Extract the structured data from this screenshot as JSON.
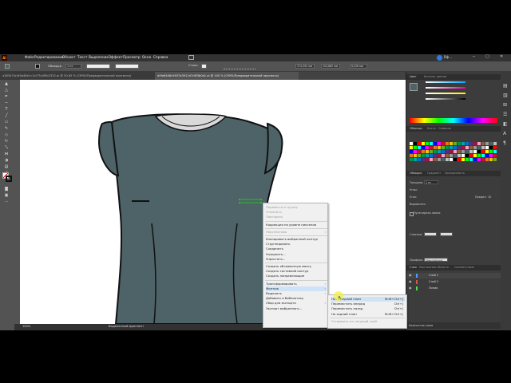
{
  "app": {
    "logo": "Ai",
    "search_label": "Вф..."
  },
  "menu": [
    "Файл",
    "Редактирование",
    "Объект",
    "Текст",
    "Выделение",
    "Эффект",
    "Просмотр",
    "Окно",
    "Справка"
  ],
  "control_bar": {
    "stroke_label": "Обводка",
    "stroke_value": "1 пт",
    "opacity_label": "Стиль:",
    "x_value": "374,592 мм",
    "y_value": "104,862 мм",
    "w_value": "6,026 мм"
  },
  "doc_tabs": [
    "a383474c4f4b48e1c1a7f7a4f5b2332.ai @ 50,65 % (CMYK/Предварительный просмотр)",
    "d4fe6448c5637a3911d7c8f3b0a1.ai @ 100 % (CMYK/Предварительный просмотр)"
  ],
  "status": {
    "zoom": "100%",
    "tool": "Выделенный фрагмент"
  },
  "panels": {
    "color_tab": "Цвет",
    "color_guide_tab": "Каталог цветов",
    "swatches_tabs": [
      "Образцы",
      "Кисти",
      "Символы"
    ],
    "stroke_tabs": [
      "Обводка",
      "Градиент",
      "Прозрачность"
    ],
    "stroke": {
      "weight_label": "Толщина:",
      "weight_value": "1 пт",
      "cap_label": "Углы:",
      "corner_label": "Угол:",
      "limit_label": "Предел:",
      "limit_value": "10",
      "align_label": "Выровнять:",
      "dashed_label": "Пунктирная линия",
      "arrows_label": "Стрелки:",
      "profile_label": "Профиль:",
      "profile_value": "Равномерный"
    },
    "layers_tabs": [
      "Слои",
      "Монтажные области",
      "Cоответствие"
    ],
    "layers": [
      "Слой 1",
      "Слой 2",
      "Линии"
    ],
    "layers_count": "Количество слоев"
  },
  "context_menu": {
    "items": [
      {
        "label": "Перевести в группу",
        "disabled": true
      },
      {
        "label": "Отменить",
        "disabled": true
      },
      {
        "label": "Повторить",
        "disabled": true
      },
      {
        "sep": true
      },
      {
        "label": "Коррекция на уровне пикселов",
        "disabled": false
      },
      {
        "sep": true
      },
      {
        "label": "Перспектива",
        "disabled": true,
        "submenu": true
      },
      {
        "sep": true
      },
      {
        "label": "Изолировать выбранный контур",
        "disabled": false
      },
      {
        "label": "Сгруппировать",
        "disabled": false
      },
      {
        "label": "Соединить",
        "disabled": false
      },
      {
        "label": "Усреднить...",
        "disabled": false
      },
      {
        "label": "Упростить...",
        "disabled": false
      },
      {
        "sep": true
      },
      {
        "label": "Создать обтравочную маску",
        "disabled": false
      },
      {
        "label": "Создать составной контур",
        "disabled": false
      },
      {
        "label": "Создать направляющие",
        "disabled": false
      },
      {
        "sep": true
      },
      {
        "label": "Трансформировать",
        "disabled": false,
        "submenu": true
      },
      {
        "label": "Монтаж",
        "disabled": false,
        "submenu": true,
        "highlight": true
      },
      {
        "label": "Выделить",
        "disabled": false,
        "submenu": true
      },
      {
        "label": "Добавить в библиотеку",
        "disabled": false
      },
      {
        "label": "Сбор для экспорта",
        "disabled": false,
        "submenu": true
      },
      {
        "label": "Экспорт выбранного...",
        "disabled": false
      }
    ]
  },
  "submenu": {
    "items": [
      {
        "label": "На передний план",
        "shortcut": "Shift+Ctrl+]",
        "highlight": true
      },
      {
        "label": "Переместить вперед",
        "shortcut": "Ctrl+]"
      },
      {
        "label": "Переместить назад",
        "shortcut": "Ctrl+["
      },
      {
        "label": "На задний план",
        "shortcut": "Shift+Ctrl+["
      },
      {
        "sep": true
      },
      {
        "label": "Отправить на текущий слой",
        "disabled": true
      }
    ]
  },
  "colors": {
    "dress_fill": "#4e6367",
    "collar_fill": "#d9d9d9",
    "outline": "#111111",
    "ui_dark": "#323232",
    "ui_mid": "#535353",
    "cursor_highlight": "#f3ef46",
    "menu_highlight": "#cfe3f7"
  }
}
